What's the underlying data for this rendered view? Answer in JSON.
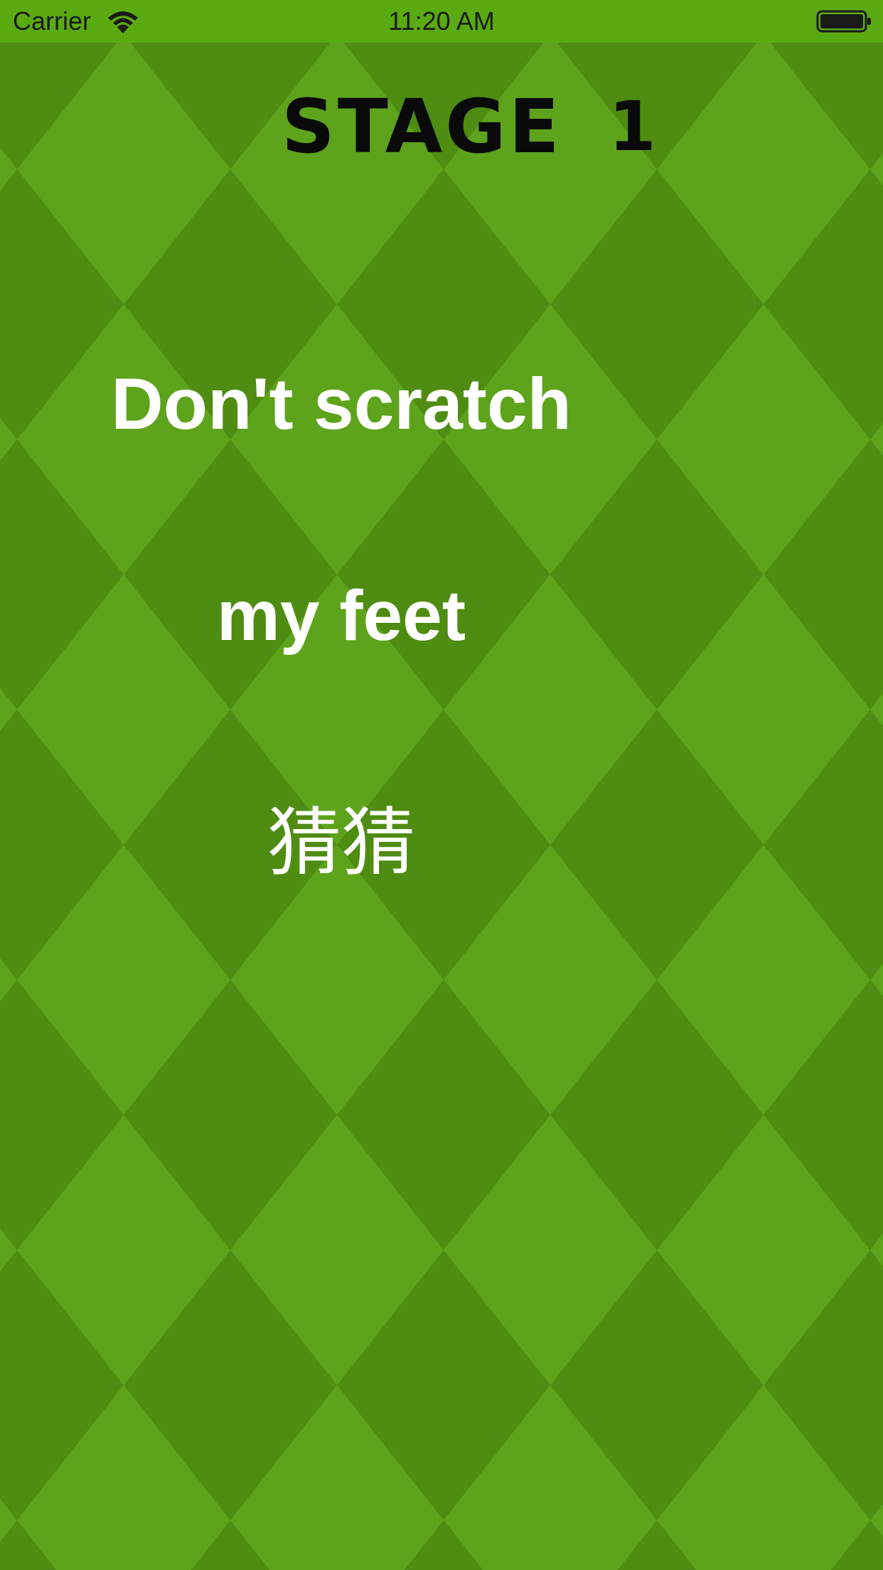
{
  "status_bar": {
    "carrier": "Carrier",
    "time": "11:20 AM",
    "wifi_icon": "wifi-icon",
    "battery_icon": "battery-icon",
    "background_color": "#5aaa12"
  },
  "header": {
    "stage_label": "STAGE",
    "stage_number": "1"
  },
  "words": [
    {
      "text": "Don't scratch"
    },
    {
      "text": "my feet"
    },
    {
      "text": "猜猜"
    }
  ],
  "colors": {
    "dark_diamond": "#4d8a12",
    "light_diamond": "#5fa21c",
    "text": "#ffffff",
    "title": "#0a0a0a"
  }
}
